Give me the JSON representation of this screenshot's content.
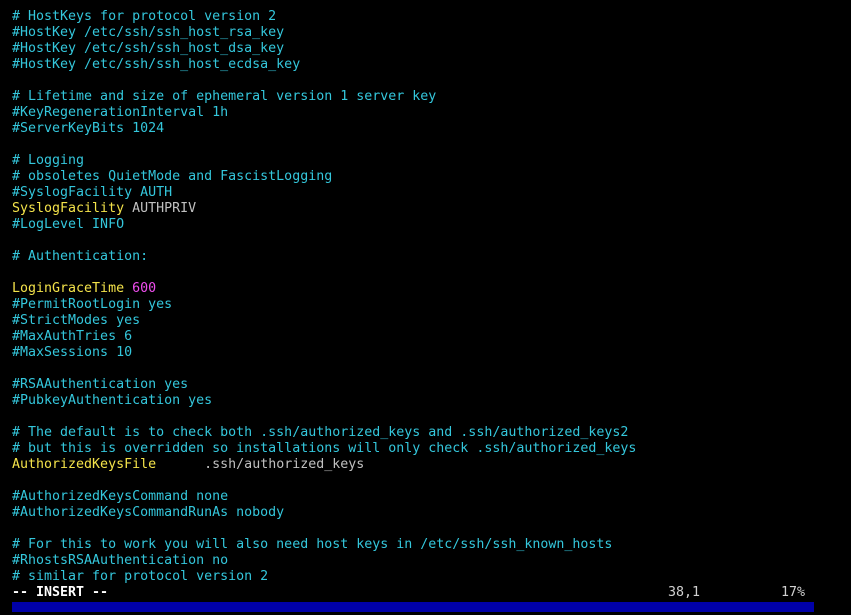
{
  "colors": {
    "background": "#000000",
    "comment": "#34c7dc",
    "keyword": "#f4e34a",
    "number": "#f04ef0",
    "value": "#c0c0c0",
    "bottom_bar": "#0000a8"
  },
  "lines": [
    "# HostKeys for protocol version 2",
    "#HostKey /etc/ssh/ssh_host_rsa_key",
    "#HostKey /etc/ssh/ssh_host_dsa_key",
    "#HostKey /etc/ssh/ssh_host_ecdsa_key",
    "",
    "# Lifetime and size of ephemeral version 1 server key",
    "#KeyRegenerationInterval 1h",
    "#ServerKeyBits 1024",
    "",
    "# Logging",
    "# obsoletes QuietMode and FascistLogging",
    "#SyslogFacility AUTH",
    {
      "keyword": "SyslogFacility",
      "sep": " ",
      "value": "AUTHPRIV"
    },
    "#LogLevel INFO",
    "",
    "# Authentication:",
    "",
    {
      "keyword": "LoginGraceTime",
      "sep": " ",
      "number": "600"
    },
    "#PermitRootLogin yes",
    "#StrictModes yes",
    "#MaxAuthTries 6",
    "#MaxSessions 10",
    "",
    "#RSAAuthentication yes",
    "#PubkeyAuthentication yes",
    "",
    "# The default is to check both .ssh/authorized_keys and .ssh/authorized_keys2",
    "# but this is overridden so installations will only check .ssh/authorized_keys",
    {
      "keyword": "AuthorizedKeysFile",
      "sep": "      ",
      "value": ".ssh/authorized_keys"
    },
    "",
    "#AuthorizedKeysCommand none",
    "#AuthorizedKeysCommandRunAs nobody",
    "",
    "# For this to work you will also need host keys in /etc/ssh/ssh_known_hosts",
    "#RhostsRSAAuthentication no",
    "# similar for protocol version 2"
  ],
  "status": {
    "mode": "-- INSERT --",
    "cursor_position": "38,1",
    "scroll_percent": "17%"
  }
}
